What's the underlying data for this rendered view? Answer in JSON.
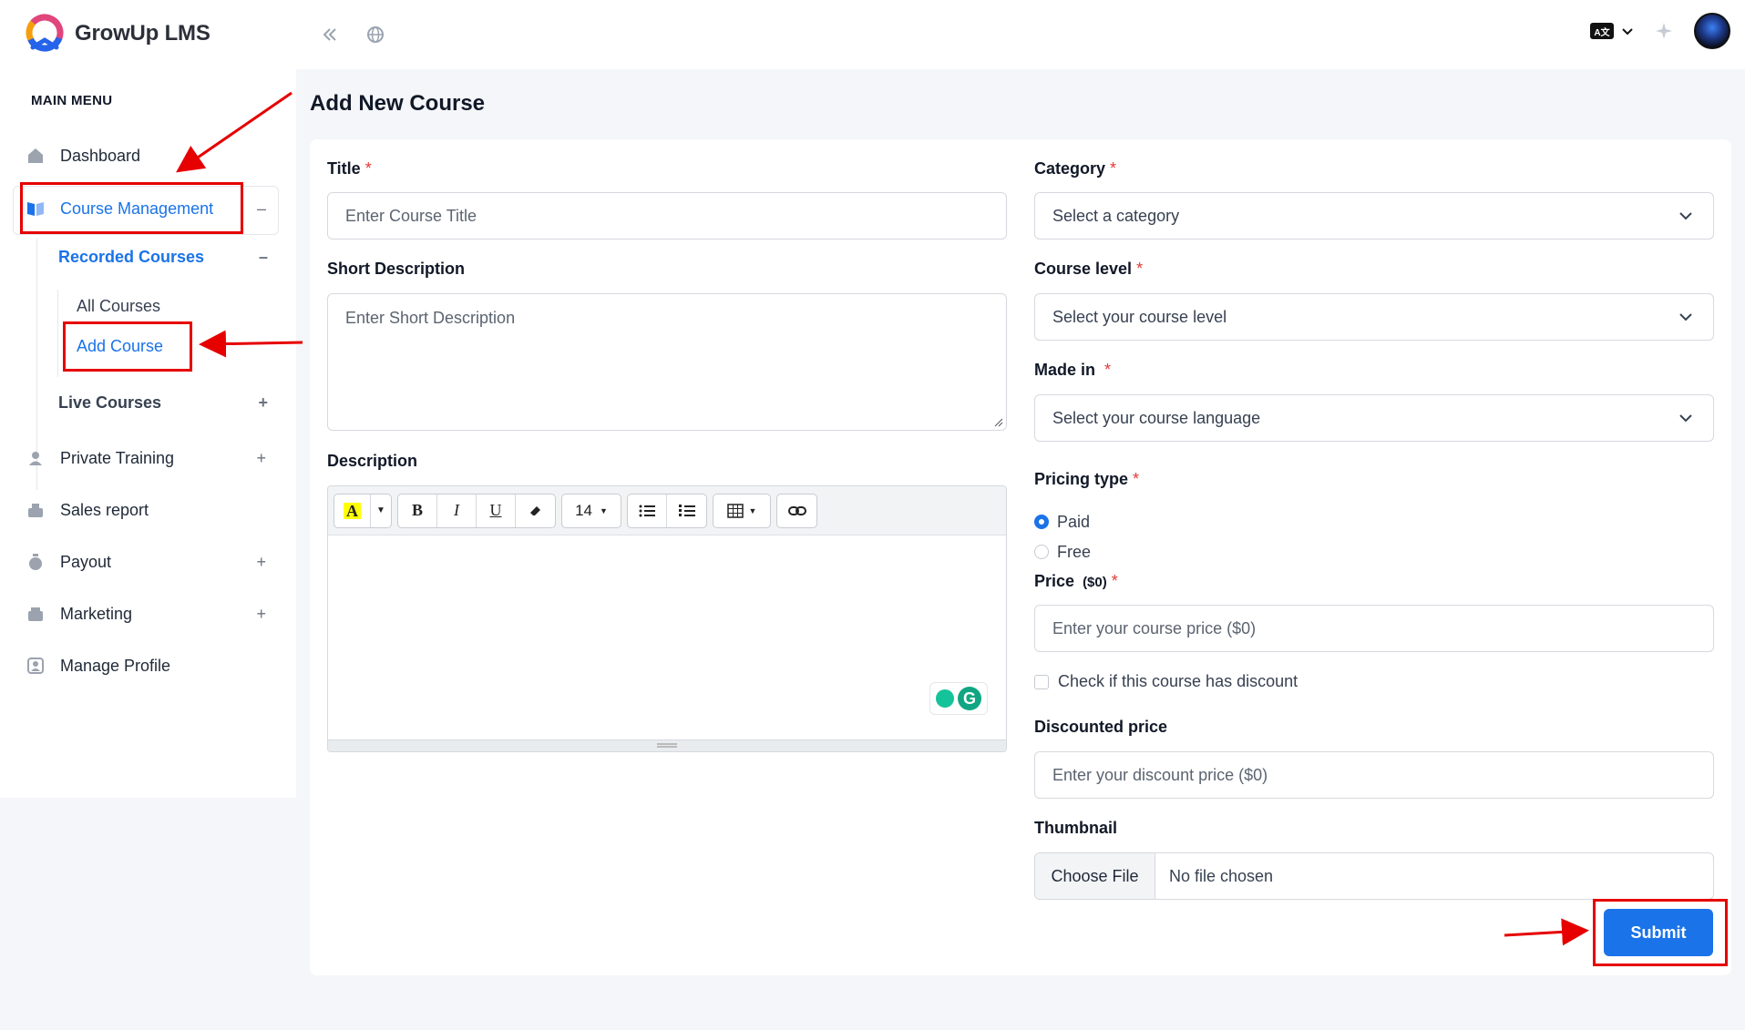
{
  "brand": {
    "name": "GrowUp LMS"
  },
  "header": {
    "language_code": "A文"
  },
  "sidebar": {
    "menu_title": "MAIN MENU",
    "items": [
      {
        "label": "Dashboard",
        "icon": "home-icon"
      },
      {
        "label": "Course Management",
        "icon": "book-icon",
        "toggle": "–"
      },
      {
        "label": "Private Training",
        "icon": "users-icon",
        "toggle": "+"
      },
      {
        "label": "Sales report",
        "icon": "chart-icon"
      },
      {
        "label": "Payout",
        "icon": "money-bag-icon",
        "toggle": "+"
      },
      {
        "label": "Marketing",
        "icon": "megaphone-icon",
        "toggle": "+"
      },
      {
        "label": "Manage Profile",
        "icon": "profile-icon"
      }
    ],
    "course_sub": {
      "recorded": {
        "label": "Recorded Courses",
        "toggle": "–"
      },
      "recorded_items": [
        {
          "label": "All Courses"
        },
        {
          "label": "Add Course"
        }
      ],
      "live": {
        "label": "Live Courses",
        "toggle": "+"
      }
    },
    "active_color": "#1a73e8"
  },
  "page": {
    "title": "Add New Course"
  },
  "form": {
    "title": {
      "label": "Title",
      "placeholder": "Enter Course Title"
    },
    "short_description": {
      "label": "Short Description",
      "placeholder": "Enter Short Description"
    },
    "description": {
      "label": "Description",
      "font_size": "14"
    },
    "category": {
      "label": "Category",
      "value": "Select a category"
    },
    "course_level": {
      "label": "Course level",
      "value": "Select your course level"
    },
    "made_in": {
      "label": "Made in",
      "value": "Select your course language"
    },
    "pricing_type": {
      "label": "Pricing type",
      "options": [
        "Paid",
        "Free"
      ],
      "selected": "Paid"
    },
    "price": {
      "label": "Price",
      "unit": "($0)",
      "placeholder": "Enter your course price ($0)"
    },
    "discount_check": {
      "label": "Check if this course has discount",
      "checked": false
    },
    "discounted_price": {
      "label": "Discounted price",
      "placeholder": "Enter your discount price ($0)"
    },
    "thumbnail": {
      "label": "Thumbnail",
      "button": "Choose File",
      "status": "No file chosen"
    },
    "submit": "Submit",
    "required_mark": "*"
  },
  "annotation_color": "#e60000"
}
